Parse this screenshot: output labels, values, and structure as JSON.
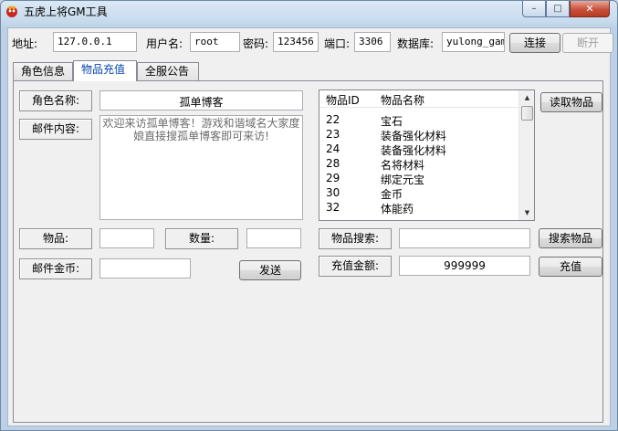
{
  "window": {
    "title": "五虎上将GM工具",
    "controls": {
      "minimize": "–",
      "maximize": "□",
      "close": "✕"
    }
  },
  "connection": {
    "address_label": "地址:",
    "address_value": "127.0.0.1",
    "username_label": "用户名:",
    "username_value": "root",
    "password_label": "密码:",
    "password_value": "123456",
    "port_label": "端口:",
    "port_value": "3306",
    "database_label": "数据库:",
    "database_value": "yulong_game",
    "connect_button": "连接",
    "disconnect_button": "断开"
  },
  "tabs": [
    {
      "label": "角色信息"
    },
    {
      "label": "物品充值"
    },
    {
      "label": "全服公告"
    }
  ],
  "panel": {
    "role_name_label": "角色名称:",
    "role_name_value": "孤单博客",
    "mail_content_label": "邮件内容:",
    "mail_content_value": "欢迎来访孤单博客！游戏和谐域名大家度娘直接搜孤单博客即可来访!",
    "item_label": "物品:",
    "item_value": "",
    "quantity_label": "数量:",
    "quantity_value": "",
    "mail_gold_label": "邮件金币:",
    "mail_gold_value": "",
    "send_button": "发送",
    "read_items_button": "读取物品",
    "item_search_label": "物品搜索:",
    "item_search_value": "",
    "search_items_button": "搜索物品",
    "recharge_amount_label": "充值金额:",
    "recharge_amount_value": "999999",
    "recharge_button": "充值"
  },
  "item_list": {
    "columns": [
      "物品ID",
      "物品名称"
    ],
    "rows": [
      {
        "id": "22",
        "name": "宝石"
      },
      {
        "id": "23",
        "name": "装备强化材料"
      },
      {
        "id": "24",
        "name": "装备强化材料"
      },
      {
        "id": "28",
        "name": "名将材料"
      },
      {
        "id": "29",
        "name": "绑定元宝"
      },
      {
        "id": "30",
        "name": "金币"
      },
      {
        "id": "32",
        "name": "体能药"
      }
    ]
  }
}
